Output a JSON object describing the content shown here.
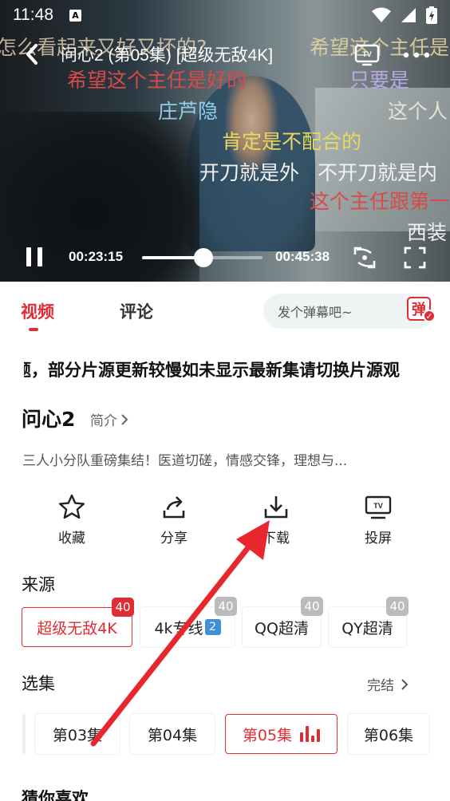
{
  "status_bar": {
    "time": "11:48",
    "notification_letter": "A"
  },
  "player": {
    "title": "问心2 (第05集) [超级无敌4K]",
    "current_time": "00:23:15",
    "total_time": "00:45:38",
    "progress_fraction": 0.51,
    "danmaku": [
      {
        "text": "怎么看起来又好又坏的?",
        "color": "#e8d8b8"
      },
      {
        "text": "希望这个主任是",
        "color": "#e8d9a0"
      },
      {
        "text": "希望这个主任是好的",
        "color": "#d94a48"
      },
      {
        "text": "只要是",
        "color": "#b9a8e6"
      },
      {
        "text": "庄芦隐",
        "color": "#8fd0ee"
      },
      {
        "text": "这个人",
        "color": "#e6e1d6"
      },
      {
        "text": "肯定是不配合的",
        "color": "#e8d860"
      },
      {
        "text": "开刀就是外",
        "color": "#f2f2f2"
      },
      {
        "text": "不开刀就是内",
        "color": "#f2f2f2"
      },
      {
        "text": "这个主任跟第一",
        "color": "#d94a48"
      },
      {
        "text": "西装",
        "color": "#f2f2f2"
      }
    ]
  },
  "tabs": {
    "video": "视频",
    "comment": "评论"
  },
  "danmaku_input": {
    "placeholder": "发个弹幕吧~",
    "toggle_label": "弹"
  },
  "notice": "题，部分片源更新较慢如未显示最新集请切换片源观",
  "show": {
    "title": "问心2",
    "intro_label": "简介",
    "synopsis": "三人小分队重磅集结！医道切磋，情感交锋，理想与..."
  },
  "actions": [
    {
      "label": "收藏",
      "icon": "star-icon"
    },
    {
      "label": "分享",
      "icon": "share-icon"
    },
    {
      "label": "下载",
      "icon": "download-icon"
    },
    {
      "label": "投屏",
      "icon": "tv-cast-icon"
    }
  ],
  "source_section": {
    "title": "来源",
    "sources": [
      {
        "label": "超级无敌4K",
        "badge": "40",
        "active": true
      },
      {
        "label": "4k专线",
        "badge": "40",
        "active": false
      },
      {
        "label": "QQ超清",
        "badge": "40",
        "active": false
      },
      {
        "label": "QY超清",
        "badge": "40",
        "active": false
      }
    ]
  },
  "episode_section": {
    "title": "选集",
    "status": "完结",
    "episodes": [
      "第03集",
      "第04集",
      "第05集",
      "第06集"
    ],
    "active_episode": "第05集"
  },
  "recommend_title": "猜你喜欢",
  "colors": {
    "accent": "#e02d33",
    "annotation_arrow": "#e8262e"
  }
}
